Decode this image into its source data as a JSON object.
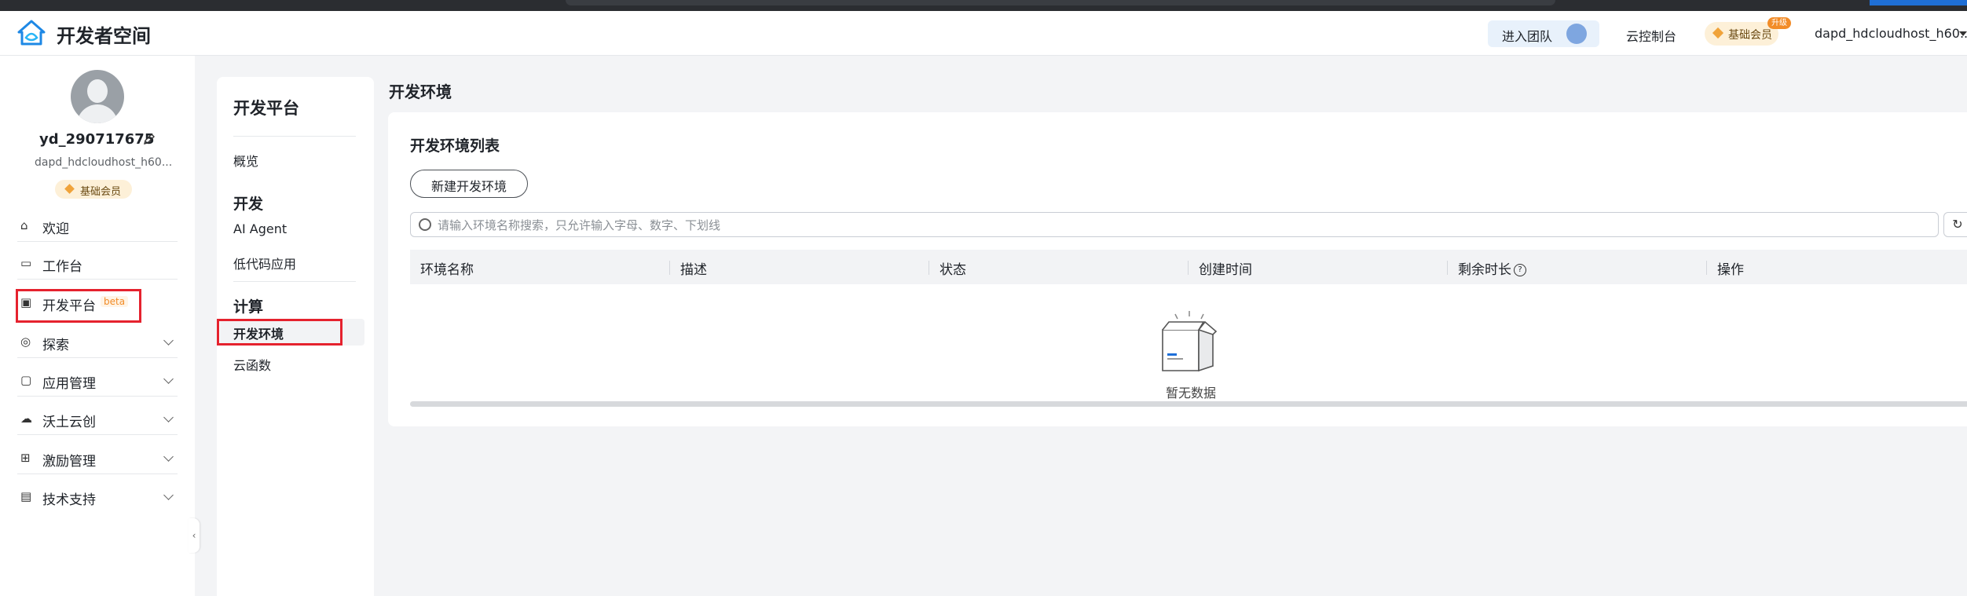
{
  "header": {
    "brand": "开发者空间",
    "team_button": "进入团队",
    "console_link": "云控制台",
    "member_badge": "基础会员",
    "upgrade_tag": "升级",
    "user": "dapd_hdcloudhost_h60..."
  },
  "profile": {
    "username": "yd_290717675",
    "account": "dapd_hdcloudhost_h60...",
    "member_badge": "基础会员"
  },
  "sidebar": {
    "items": [
      {
        "label": "欢迎",
        "icon": "home-icon"
      },
      {
        "label": "工作台",
        "icon": "workbench-icon"
      },
      {
        "label": "开发平台",
        "icon": "dev-platform-icon",
        "tag": "beta"
      },
      {
        "label": "探索",
        "icon": "explore-icon"
      },
      {
        "label": "应用管理",
        "icon": "app-management-icon"
      },
      {
        "label": "沃土云创",
        "icon": "cloud-icon"
      },
      {
        "label": "激励管理",
        "icon": "gift-icon"
      },
      {
        "label": "技术支持",
        "icon": "support-icon"
      }
    ]
  },
  "subnav": {
    "title": "开发平台",
    "overview": "概览",
    "group_dev": "开发",
    "ai_agent": "AI Agent",
    "lowcode": "低代码应用",
    "group_compute": "计算",
    "dev_env": "开发环境",
    "cloud_func": "云函数"
  },
  "main": {
    "title": "开发环境",
    "card_title": "开发环境列表",
    "new_button": "新建开发环境",
    "search_placeholder": "请输入环境名称搜索，只允许输入字母、数字、下划线",
    "columns": [
      "环境名称",
      "描述",
      "状态",
      "创建时间",
      "剩余时长",
      "操作"
    ],
    "empty_text": "暂无数据"
  },
  "colors": {
    "accent_red": "#e5222e",
    "badge_gold": "#f0a33a",
    "upgrade_orange": "#f28c28"
  }
}
